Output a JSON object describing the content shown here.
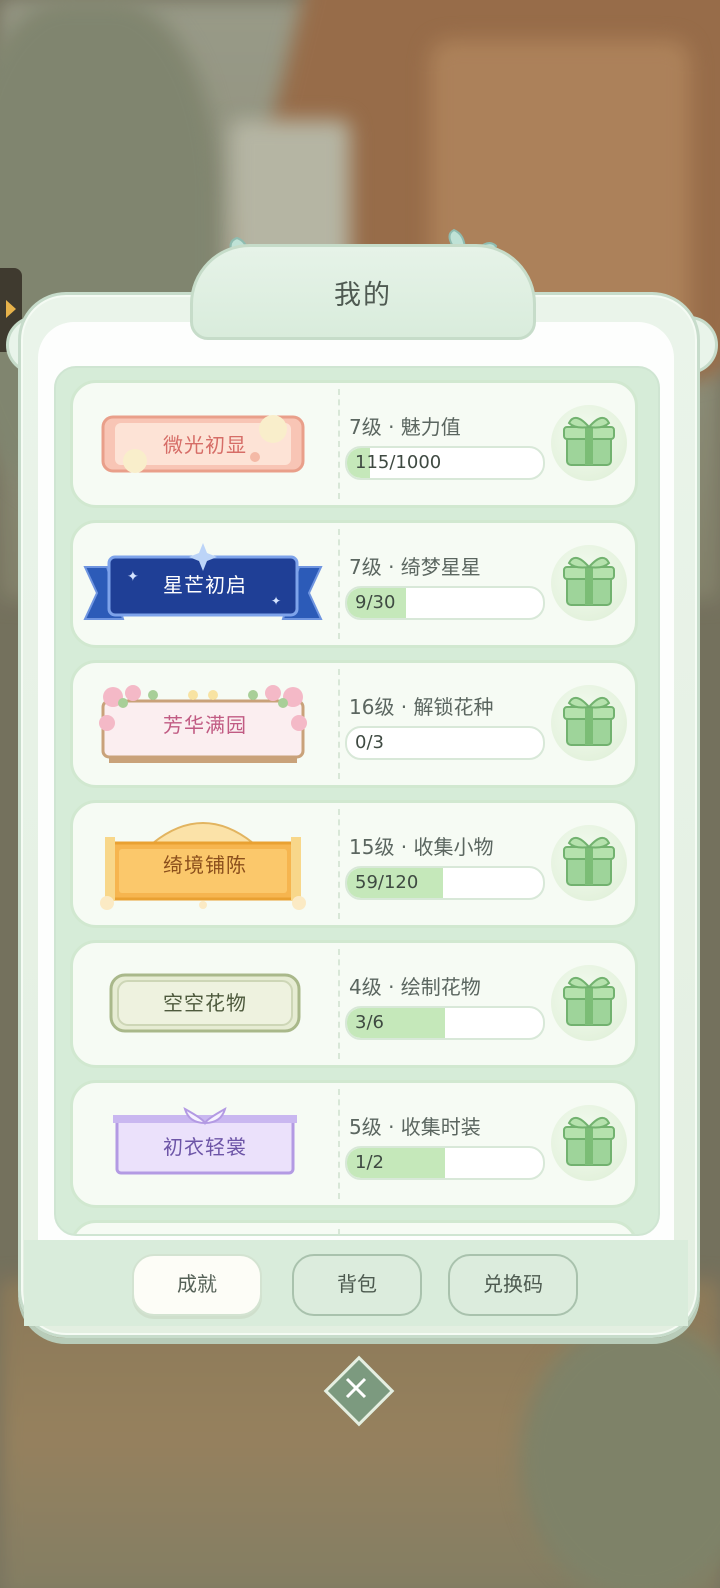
{
  "header": {
    "title": "我的"
  },
  "achievements": [
    {
      "badge": "微光初显",
      "task": "7级 · 魅力值",
      "progress_text": "115/1000",
      "progress": 0.115
    },
    {
      "badge": "星芒初启",
      "task": "7级 · 绮梦星星",
      "progress_text": "9/30",
      "progress": 0.3
    },
    {
      "badge": "芳华满园",
      "task": "16级 · 解锁花种",
      "progress_text": "0/3",
      "progress": 0.0
    },
    {
      "badge": "绮境铺陈",
      "task": "15级 · 收集小物",
      "progress_text": "59/120",
      "progress": 0.49
    },
    {
      "badge": "空空花物",
      "task": "4级 · 绘制花物",
      "progress_text": "3/6",
      "progress": 0.5
    },
    {
      "badge": "初衣轻裳",
      "task": "5级 · 收集时装",
      "progress_text": "1/2",
      "progress": 0.5
    }
  ],
  "tabs": {
    "achievements": "成就",
    "bag": "背包",
    "redeem": "兑换码"
  },
  "icons": {
    "reward": "gift-box-icon",
    "close": "close-icon",
    "side": "side-expand-arrow-icon"
  },
  "colors": {
    "accent": "#7c9a7f",
    "progress_fill": "#c5e8ba"
  }
}
